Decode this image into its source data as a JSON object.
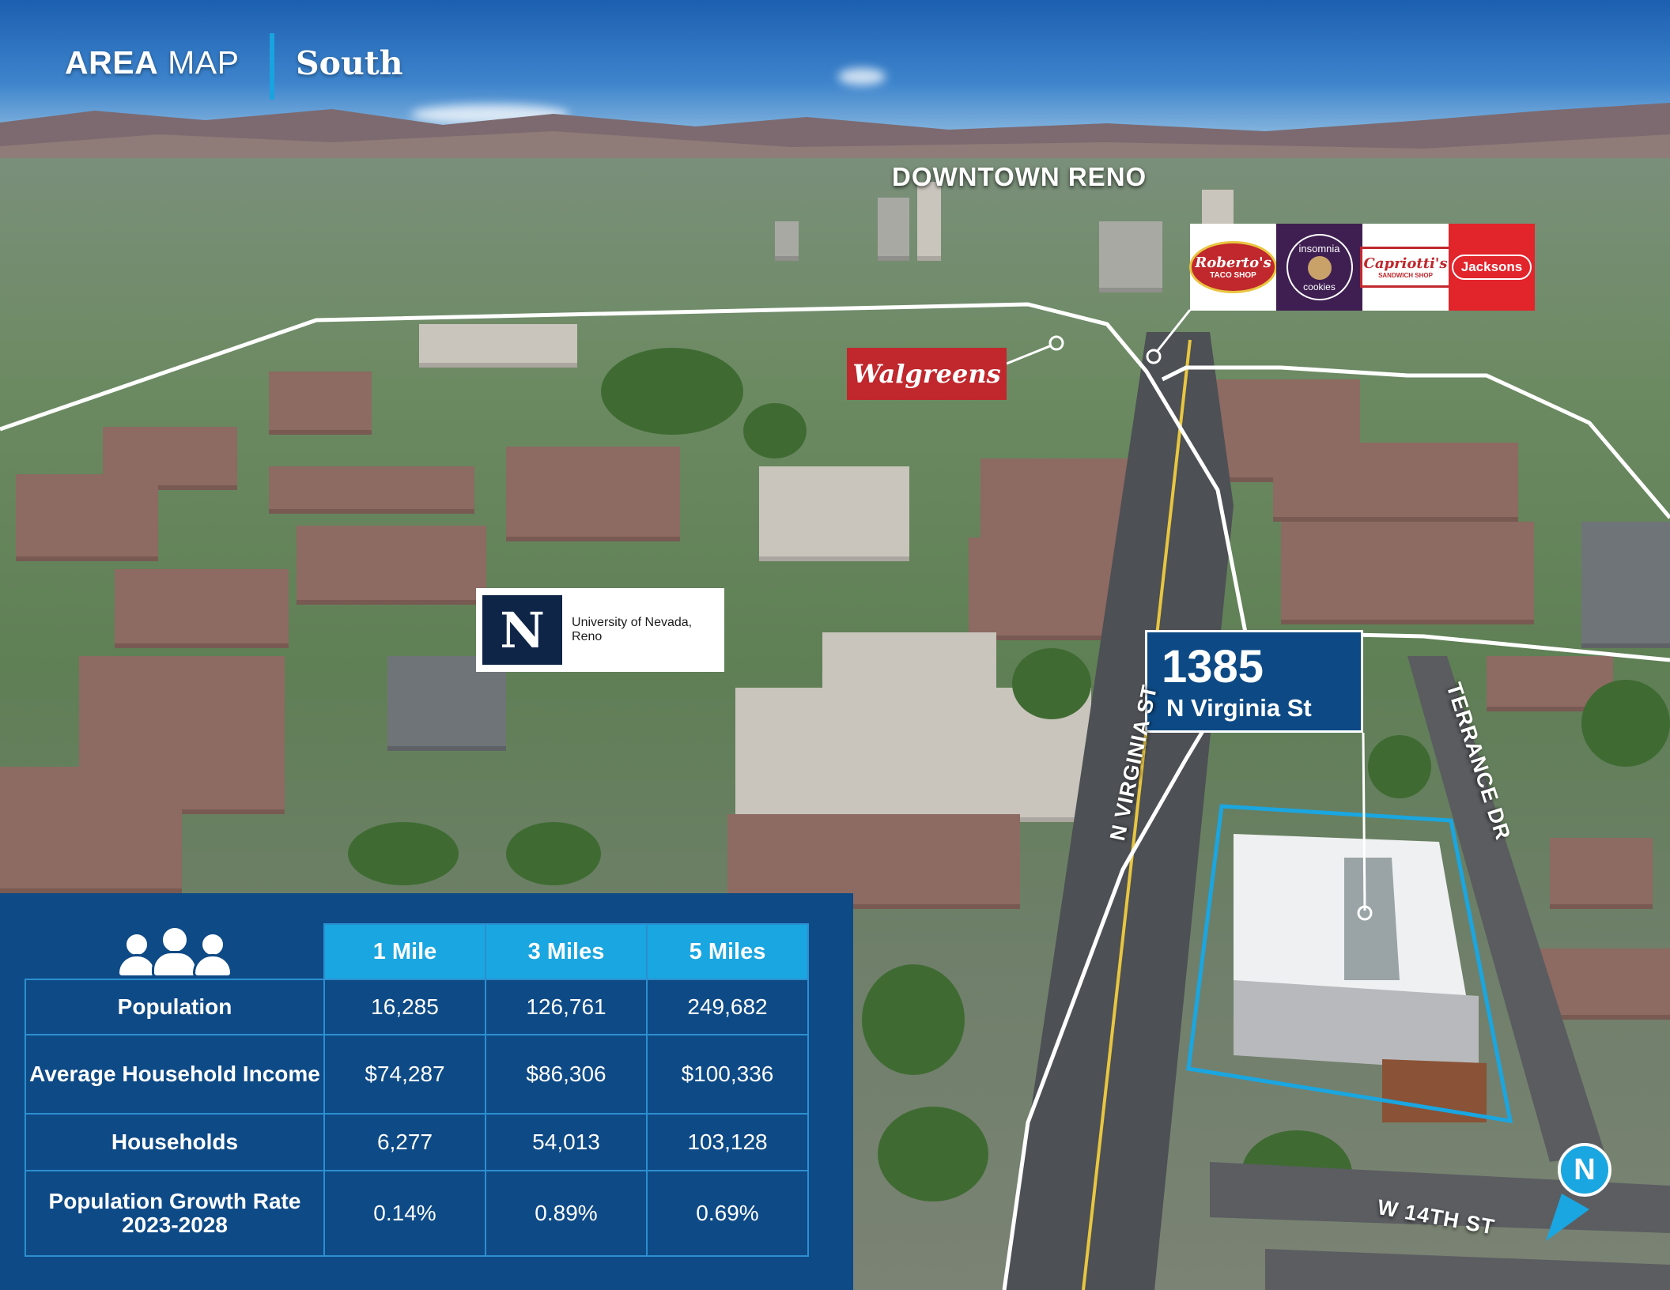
{
  "header": {
    "title_bold": "AREA",
    "title_light": " MAP",
    "subtitle": "South"
  },
  "labels": {
    "downtown": "DOWNTOWN RENO",
    "n_virginia": "N VIRGINIA ST",
    "terrance": "TERRANCE DR",
    "w14th": "W 14TH ST",
    "north": "N"
  },
  "logos": {
    "walgreens": "Walgreens",
    "unr_mark": "N",
    "unr_text": "University of Nevada, Reno",
    "robertos": "Roberto's",
    "robertos_sub": "TACO SHOP",
    "insomnia": "insomnia",
    "insomnia_sub": "cookies",
    "capriottis": "Capriotti's",
    "capriottis_sub": "SANDWICH SHOP",
    "jacksons": "Jacksons"
  },
  "property": {
    "number": "1385",
    "street": "N Virginia St"
  },
  "demographics": {
    "columns": [
      "1 Mile",
      "3 Miles",
      "5 Miles"
    ],
    "rows": [
      {
        "label": "Population",
        "values": [
          "16,285",
          "126,761",
          "249,682"
        ]
      },
      {
        "label": "Average Household Income",
        "values": [
          "$74,287",
          "$86,306",
          "$100,336"
        ]
      },
      {
        "label": "Households",
        "values": [
          "6,277",
          "54,013",
          "103,128"
        ]
      },
      {
        "label": "Population Growth Rate 2023-2028",
        "values": [
          "0.14%",
          "0.89%",
          "0.69%"
        ]
      }
    ]
  },
  "colors": {
    "navy": "#0e4a86",
    "accent": "#1aa6e0",
    "boundary": "#ffffff",
    "site": "#1aa6e0"
  }
}
